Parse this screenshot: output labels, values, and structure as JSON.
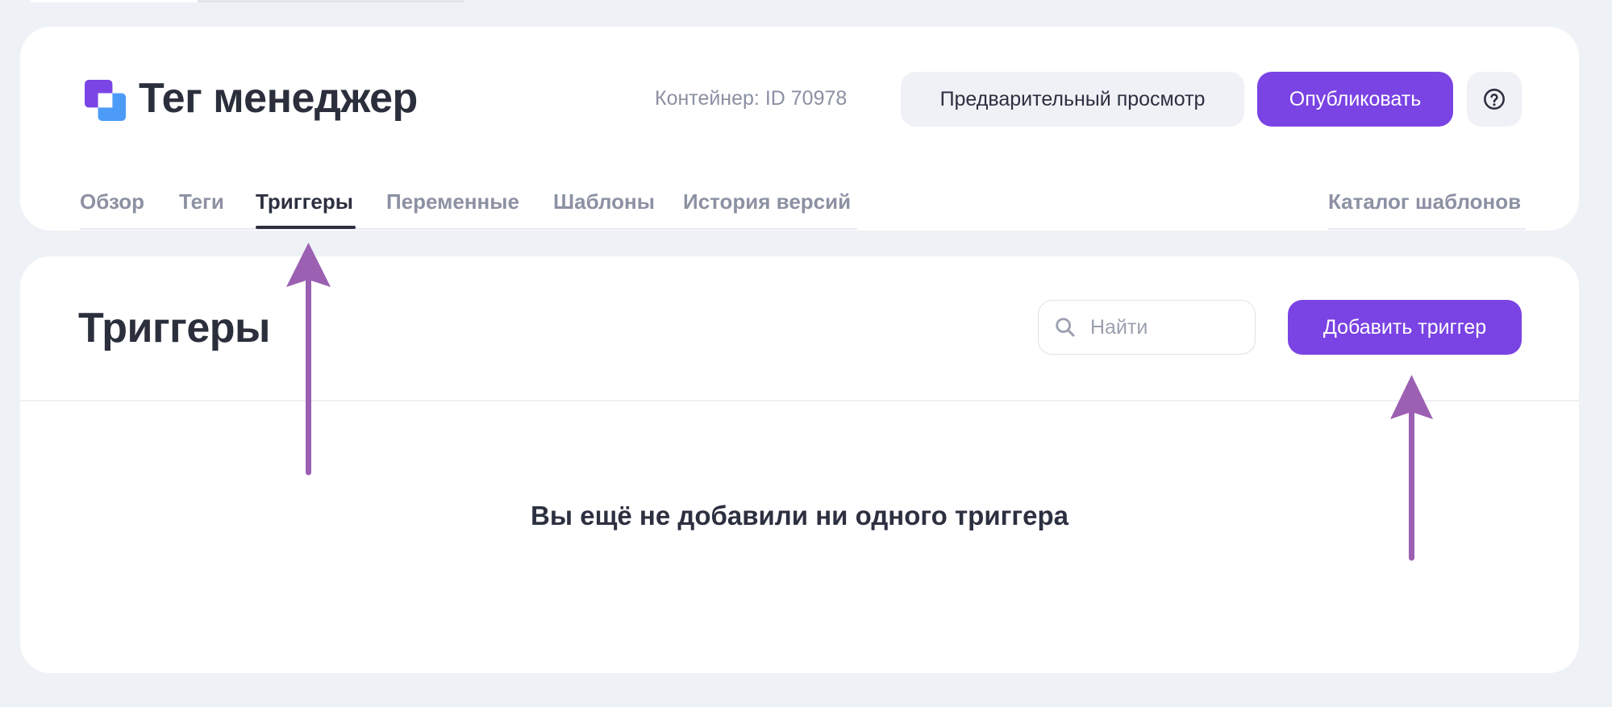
{
  "app": {
    "name": "Тег менеджер",
    "container_label": "Контейнер: ID 70978"
  },
  "header": {
    "preview_label": "Предварительный просмотр",
    "publish_label": "Опубликовать",
    "tabs": [
      {
        "label": "Обзор",
        "active": false
      },
      {
        "label": "Теги",
        "active": false
      },
      {
        "label": "Триггеры",
        "active": true
      },
      {
        "label": "Переменные",
        "active": false
      },
      {
        "label": "Шаблоны",
        "active": false
      },
      {
        "label": "История версий",
        "active": false
      }
    ],
    "catalog_label": "Каталог шаблонов"
  },
  "main": {
    "title": "Триггеры",
    "search": {
      "placeholder": "Найти"
    },
    "add_label": "Добавить триггер",
    "empty_message": "Вы ещё не добавили ни одного триггера"
  },
  "icons": {
    "logo": "logo-icon",
    "help": "help-circle-icon",
    "search": "search-icon",
    "annotation": "arrow-up-icon"
  },
  "colors": {
    "accent": "#7a43e3",
    "page_background": "#eef1f6",
    "text_primary": "#2c3040",
    "text_muted": "#8c91a3",
    "annotation_arrow": "#9c60b3"
  }
}
